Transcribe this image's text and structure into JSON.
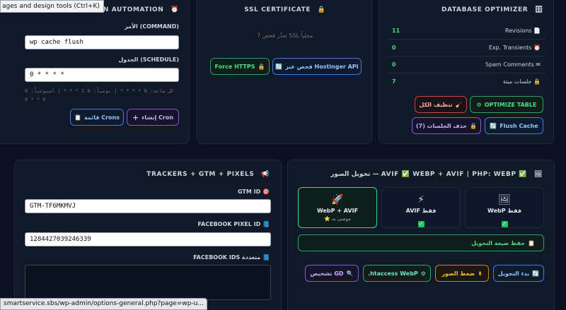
{
  "tooltip": "ages and design tools (Ctrl+K)",
  "status_url": "smartservice.sbs/wp-admin/options-general.php?page=wp-u...",
  "cron": {
    "title": "CRON AUTOMATION",
    "icon": "alarm-clock-icon",
    "command_label": "الأمر (COMMAND)",
    "command_value": "wp cache flush",
    "schedule_label": "الجدول (SCHEDULE)",
    "schedule_value": "0 * * * *",
    "hint_line1": "كل ساعة: 0 * * * * | يومياً: 0 2 * * * | أسبوعياً: 0",
    "hint_line2": "0 * * 0",
    "create_label": "إنشاء Cron",
    "list_label": "قائمة Crons"
  },
  "ssl": {
    "title": "SSL CERTIFICATE",
    "icon": "lock-icon",
    "question": "تعذّر فحص SSL محلياً",
    "check_label": "فحص عبر Hostinger API",
    "force_label": "Force HTTPS"
  },
  "db": {
    "title": "DATABASE OPTIMIZER",
    "icon": "database-icon",
    "rows": [
      {
        "value": "11",
        "label": "Revisions"
      },
      {
        "value": "0",
        "label": "Exp. Transients"
      },
      {
        "value": "0",
        "label": "Spam Comments"
      },
      {
        "value": "7",
        "label": "جلسات ميتة"
      }
    ],
    "clean_all": "تنظيف الكل",
    "optimize_table": "OPTIMIZE TABLE",
    "flush_cache": "Flush Cache",
    "delete_sessions": "حذف الجلسات (7)"
  },
  "trackers": {
    "title": "TRACKERS + GTM + PIXELS",
    "icon": "megaphone-icon",
    "gtm_label": "GTM ID",
    "gtm_value": "GTM-TF6MKMVJ",
    "fb_label": "FACEBOOK PIXEL ID",
    "fb_value": "1284427039246339",
    "fb_ids_label": "FACEBOOK IDS متعددة"
  },
  "images": {
    "title": "تحويل الصور — AVIF ✅ WEBP + AVIF | PHP: WEBP ✅",
    "options": [
      {
        "icon": "🖼",
        "name": "WebP فقط",
        "sub": ""
      },
      {
        "icon": "⚡",
        "name": "AVIF فقط",
        "sub": ""
      },
      {
        "icon": "🚀",
        "name": "WebP + AVIF",
        "sub": "⭐ موصى به"
      }
    ],
    "save_format": "حفظ صيغة التحويل",
    "start_convert": "بدء التحويل",
    "compress": "ضغط الصور",
    "htaccess": ".htaccess WebP",
    "diagnose": "تشخيص GD"
  }
}
